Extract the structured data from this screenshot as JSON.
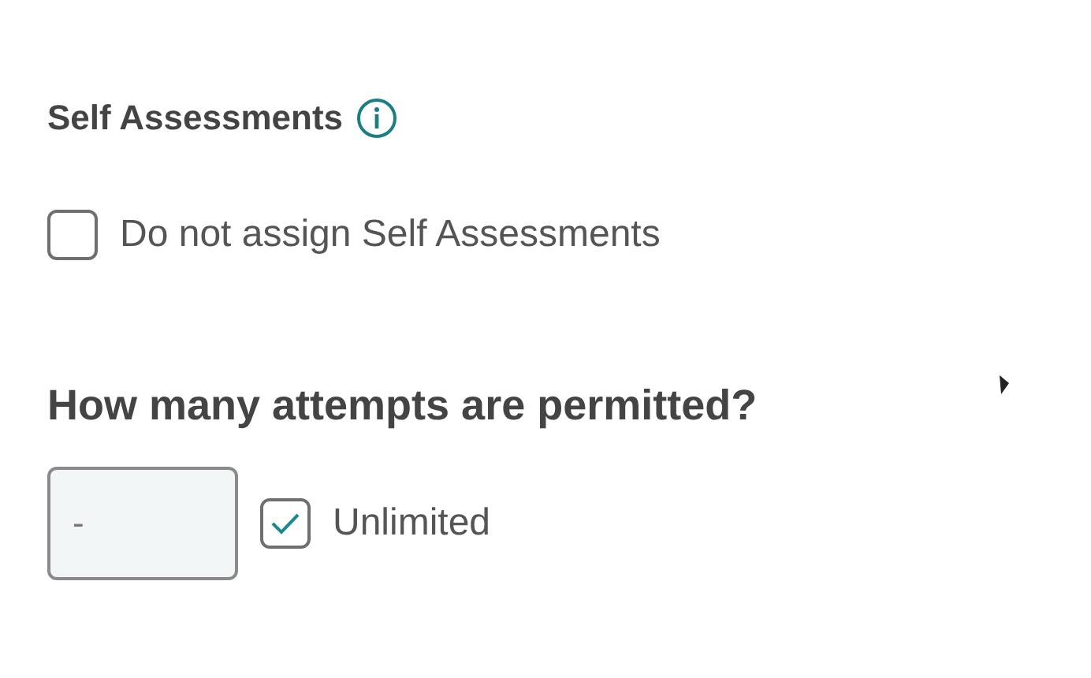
{
  "self_assessments": {
    "title": "Self Assessments",
    "checkbox": {
      "label": "Do not assign Self Assessments",
      "checked": false
    }
  },
  "attempts": {
    "question": "How many attempts are permitted?",
    "field": {
      "value": "-",
      "disabled": true
    },
    "unlimited": {
      "label": "Unlimited",
      "checked": true
    }
  }
}
